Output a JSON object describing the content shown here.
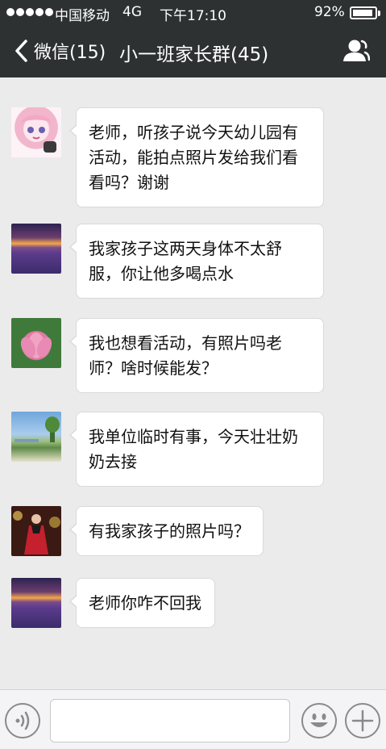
{
  "status_bar": {
    "carrier": "中国移动",
    "network": "4G",
    "time": "下午17:10",
    "battery_percent": "92%",
    "battery_level": 0.92
  },
  "nav": {
    "back_label": "微信(15)",
    "title": "小一班家长群(45)",
    "back_icon": "chevron-left-icon",
    "group_icon": "group-members-icon"
  },
  "messages": [
    {
      "avatar": "anime-girl-avatar",
      "text": "老师，听孩子说今天幼儿园有活动，能拍点照片发给我们看看吗？谢谢"
    },
    {
      "avatar": "lavender-field-avatar",
      "text": "我家孩子这两天身体不太舒服，你让他多喝点水"
    },
    {
      "avatar": "lotus-flower-avatar",
      "text": "我也想看活动，有照片吗老师？啥时候能发？"
    },
    {
      "avatar": "park-sky-avatar",
      "text": "我单位临时有事，今天壮壮奶奶去接"
    },
    {
      "avatar": "woman-red-dress-avatar",
      "text": "有我家孩子的照片吗？"
    },
    {
      "avatar": "lavender-field-avatar",
      "text": "老师你咋不回我"
    }
  ],
  "input_bar": {
    "voice_icon": "voice-icon",
    "emoji_icon": "emoji-icon",
    "plus_icon": "plus-icon",
    "input_value": ""
  },
  "colors": {
    "header_bg": "#2e3132",
    "chat_bg": "#ebebeb",
    "bubble_bg": "#ffffff"
  }
}
